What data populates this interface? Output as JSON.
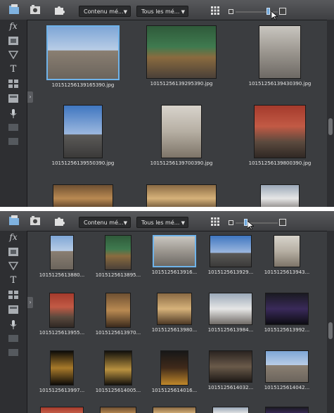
{
  "toolbar": {
    "content_filter": "Contenu mé...",
    "media_filter": "Tous les mé..."
  },
  "sidebar": {
    "fx_label": "fx",
    "text_label": "T"
  },
  "panel1": {
    "captions": [
      "10151256139165390.jpg",
      "10151256139295390.jpg",
      "10151256139430390.jpg",
      "10151256139550390.jpg",
      "10151256139700390.jpg",
      "10151256139800390.jpg"
    ],
    "zoom_level": 0.78
  },
  "panel2": {
    "captions": [
      "1015125613880...",
      "1015125613895...",
      "1015125613916...",
      "1015125613929...",
      "1015125613943...",
      "1015125613955...",
      "1015125613970...",
      "1015125613980...",
      "1015125613984...",
      "1015125613992...",
      "1015125613997...",
      "1015125614005...",
      "1015125614016...",
      "1015125614032...",
      "1015125614042..."
    ],
    "zoom_level": 0.25
  },
  "colors": {
    "selection": "#6fb3ea",
    "panel_bg": "#3b3d40"
  }
}
